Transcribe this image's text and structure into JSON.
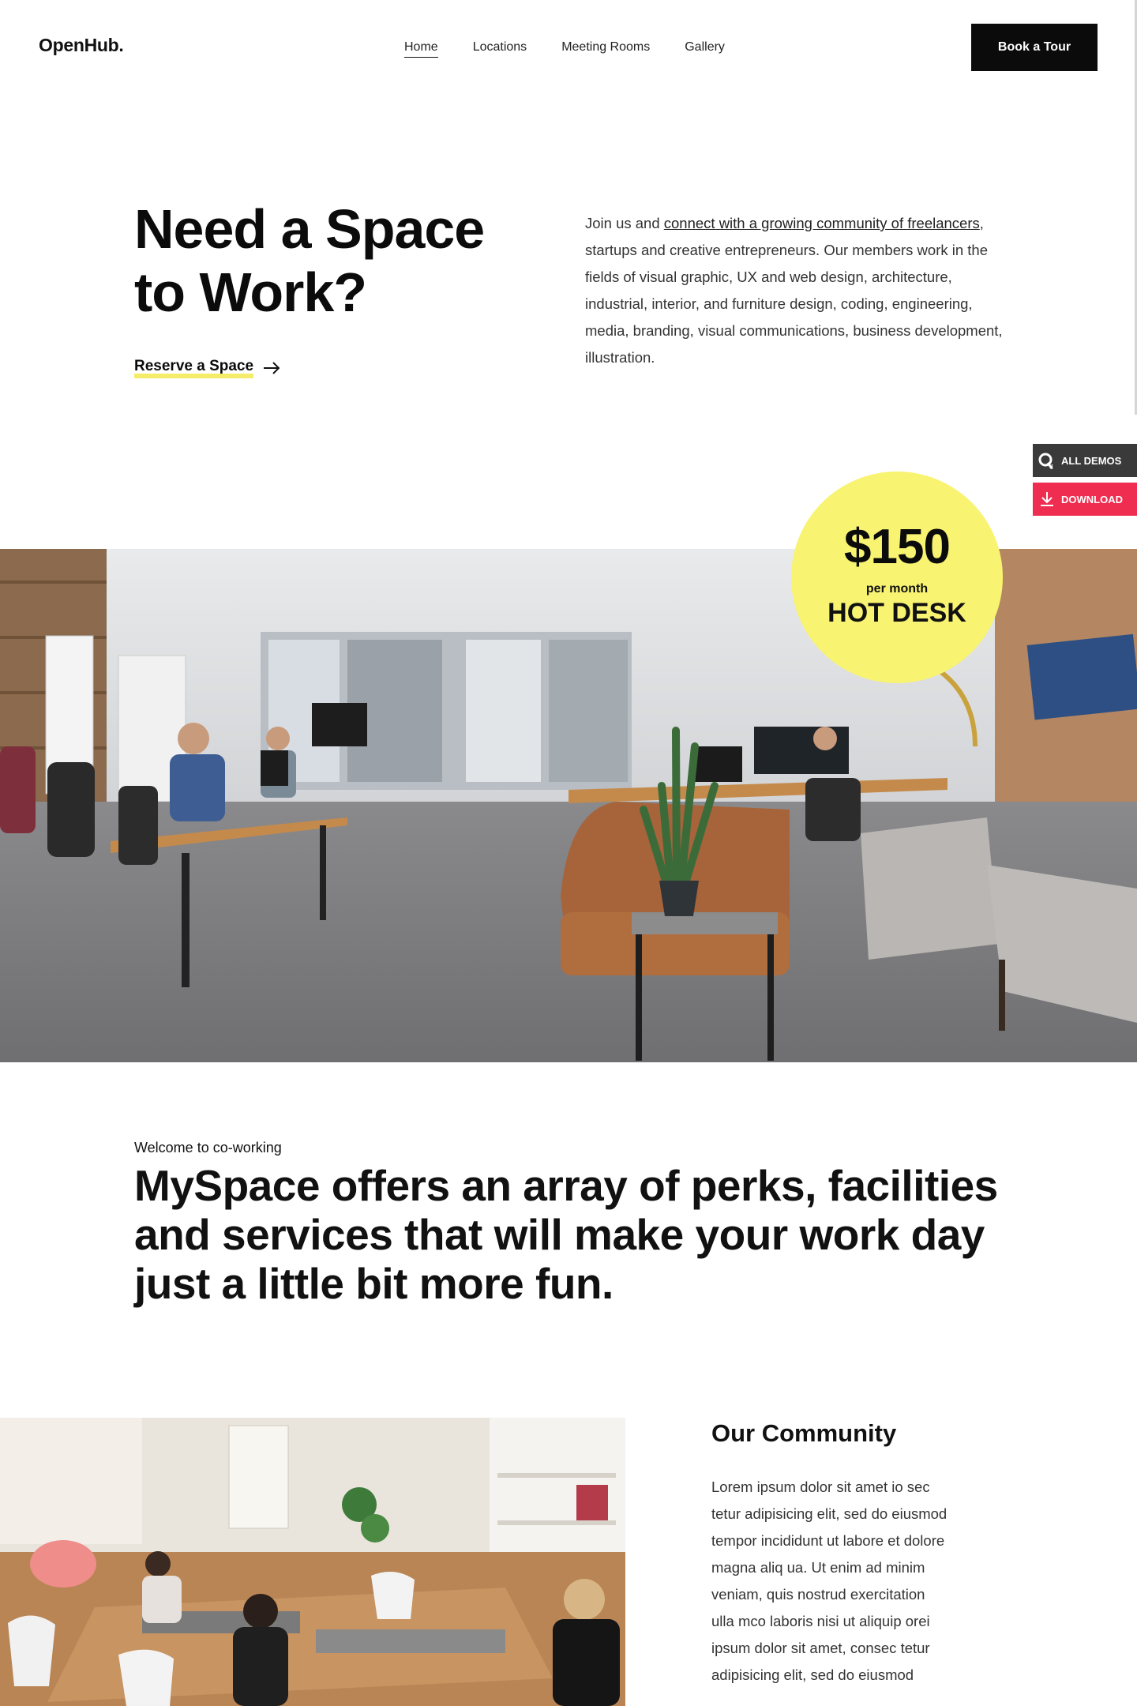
{
  "header": {
    "logo": "OpenHub.",
    "nav": [
      {
        "label": "Home",
        "active": true
      },
      {
        "label": "Locations",
        "active": false
      },
      {
        "label": "Meeting Rooms",
        "active": false
      },
      {
        "label": "Gallery",
        "active": false
      }
    ],
    "cta_label": "Book a Tour"
  },
  "hero": {
    "title_line1": "Need a Space",
    "title_line2": "to Work?",
    "reserve_label": "Reserve a Space",
    "desc_prefix": "Join us and ",
    "desc_link": "connect with a growing community of freelancers",
    "desc_suffix": ", startups and creative entrepreneurs. Our members work in the fields of visual graphic, UX and web design, architecture, industrial, interior, and furniture design, coding, engineering, media, branding, visual communications, business development, illustration."
  },
  "side_widget": {
    "demos_label": "ALL DEMOS",
    "download_label": "DOWNLOAD",
    "demos_color": "#3a3a3a",
    "download_color": "#ee2d50"
  },
  "badge": {
    "price": "$150",
    "period": "per month",
    "type": "HOT DESK",
    "color": "#f8f371"
  },
  "welcome": {
    "kicker": "Welcome to co-working",
    "headline": "MySpace offers an array of perks, facilities and services that will make your work day just a little bit more fun."
  },
  "community": {
    "title": "Our Community",
    "body": "Lorem ipsum dolor sit amet io sec tetur adipisicing elit, sed do eiusmod tempor incididunt ut labore et dolore magna aliq ua. Ut enim ad minim veniam, quis nostrud exercitation ulla mco laboris nisi ut aliquip orei ipsum dolor sit amet, consec tetur adipisicing elit, sed do eiusmod"
  }
}
